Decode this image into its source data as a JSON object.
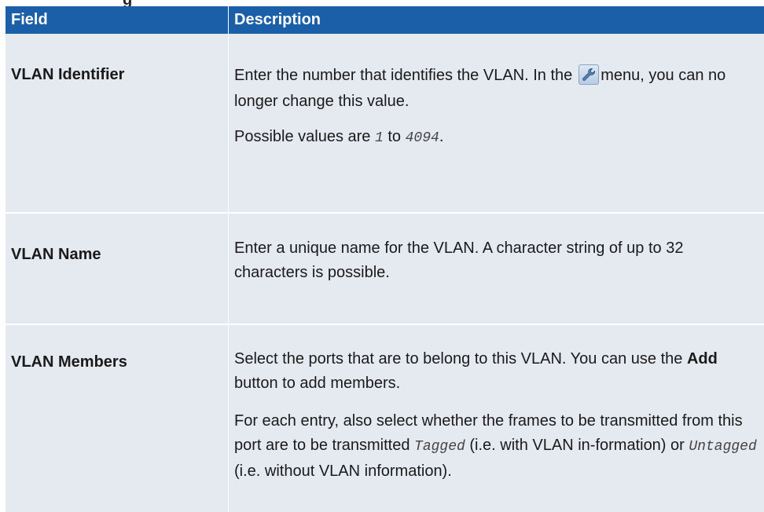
{
  "top_strip_text": "g",
  "table": {
    "headers": [
      "Field",
      "Description"
    ],
    "rows": [
      {
        "field": "VLAN Identifier",
        "p1_before_icon": "Enter the number that identifies the VLAN. In the",
        "icon": "wrench-icon",
        "p1_after_icon": "menu, you can no longer change this value.",
        "p2_before": "Possible values are",
        "value_min": "1",
        "p2_middle": "to",
        "value_max": "4094",
        "p2_end": "."
      },
      {
        "field": "VLAN Name",
        "p1": "Enter a unique name for the VLAN. A character string of up to 32 characters is possible."
      },
      {
        "field": "VLAN Members",
        "p1_before": "Select the ports that are to belong to this VLAN. You can use the",
        "p1_bold": "Add",
        "p1_after": "button to add members.",
        "p2_a": "For each entry, also select whether the frames to be transmitted from this port are to be transmitted",
        "p2_tagged": "Tagged",
        "p2_b": "(i.e. with VLAN in-formation) or",
        "p2_untagged": "Untagged",
        "p2_c": "(i.e. without VLAN information)."
      }
    ]
  }
}
